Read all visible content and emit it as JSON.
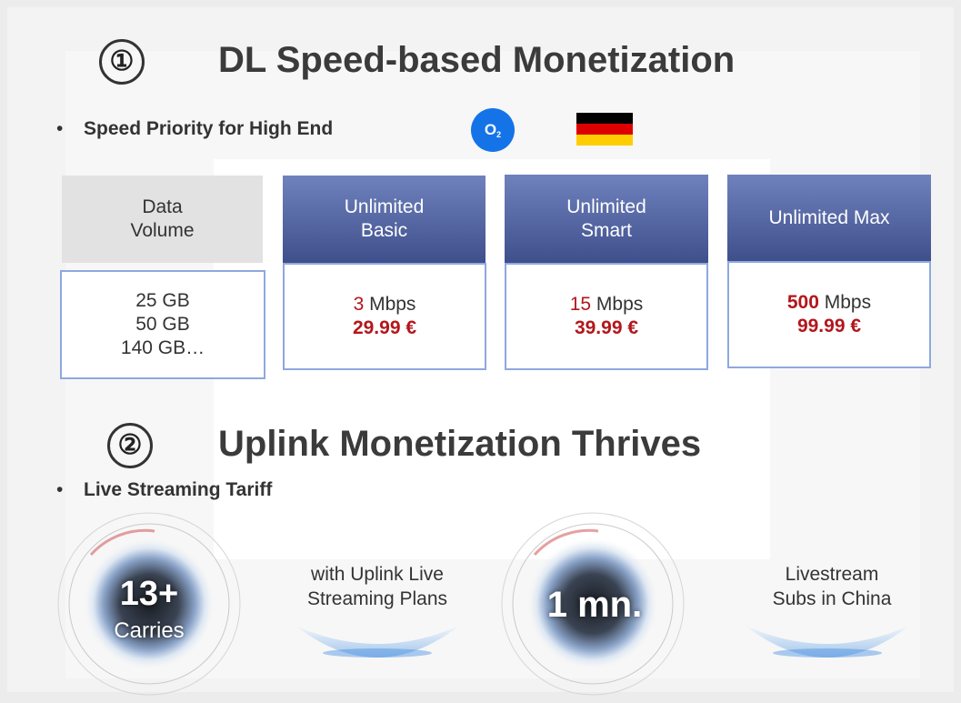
{
  "section1": {
    "number": "①",
    "title": "DL Speed-based Monetization",
    "bullet": "Speed Priority for High End",
    "operator_logo": {
      "text": "O",
      "sub": "2",
      "color": "#1573e8"
    },
    "flag_colors": [
      "#000000",
      "#dd0000",
      "#ffce00"
    ]
  },
  "table": {
    "headers": [
      {
        "line1": "Data",
        "line2": "Volume"
      },
      {
        "line1": "Unlimited",
        "line2": "Basic"
      },
      {
        "line1": "Unlimited",
        "line2": "Smart"
      },
      {
        "line1": "Unlimited Max",
        "line2": ""
      }
    ],
    "data_volume": [
      "25 GB",
      "50 GB",
      "140 GB…"
    ],
    "plans": [
      {
        "speed": "3",
        "unit": " Mbps",
        "price": "29.99 €"
      },
      {
        "speed": "15",
        "unit": " Mbps",
        "price": "39.99 €"
      },
      {
        "speed": "500",
        "unit": " Mbps",
        "price": "99.99 €"
      }
    ]
  },
  "section2": {
    "number": "②",
    "title": "Uplink Monetization Thrives",
    "bullet": "Live Streaming Tariff"
  },
  "stats": [
    {
      "value": "13+",
      "label": "Carries",
      "description_line1": "with Uplink Live",
      "description_line2": "Streaming Plans"
    },
    {
      "value": "1 mn.",
      "label": "",
      "description_line1": "Livestream",
      "description_line2": "Subs in China"
    }
  ],
  "colors": {
    "header_blue": "#4f60a0",
    "accent_red": "#b3161b",
    "border_blue": "#8fa8de"
  }
}
